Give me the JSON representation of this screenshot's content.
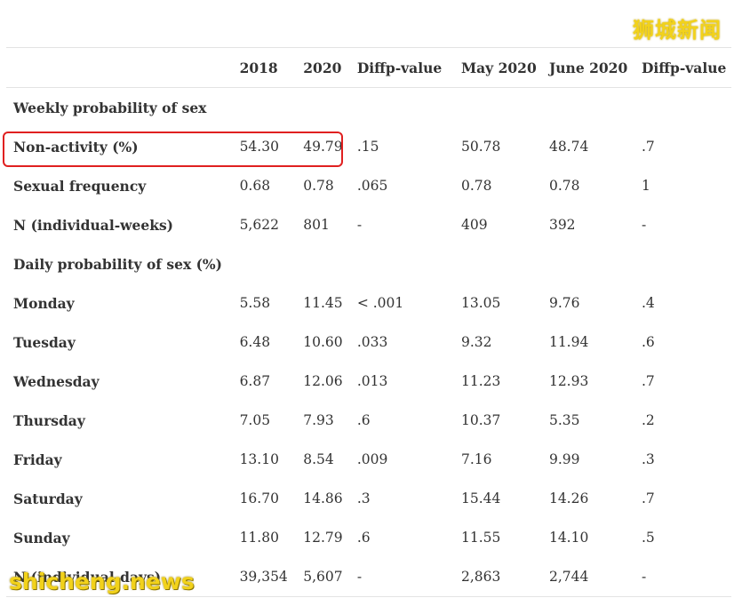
{
  "watermarks": {
    "top": "狮城新闻",
    "bottom": "shicheng.news"
  },
  "table": {
    "headers": [
      "",
      "2018",
      "2020",
      "Diffp-value",
      "May 2020",
      "June 2020",
      "Diffp-value"
    ],
    "rows": [
      {
        "type": "section",
        "label": "Weekly probability of sex",
        "cells": []
      },
      {
        "type": "data",
        "label": "Non-activity (%)",
        "cells": [
          "54.30",
          "49.79",
          ".15",
          "50.78",
          "48.74",
          ".7"
        ],
        "highlighted": true
      },
      {
        "type": "data",
        "label": "Sexual frequency",
        "cells": [
          "0.68",
          "0.78",
          ".065",
          "0.78",
          "0.78",
          "1"
        ]
      },
      {
        "type": "data",
        "label": "N (individual-weeks)",
        "cells": [
          "5,622",
          "801",
          "-",
          "409",
          "392",
          "-"
        ]
      },
      {
        "type": "section",
        "label": "Daily probability of sex (%)",
        "cells": []
      },
      {
        "type": "data",
        "label": "Monday",
        "cells": [
          "5.58",
          "11.45",
          "< .001",
          "13.05",
          "9.76",
          ".4"
        ]
      },
      {
        "type": "data",
        "label": "Tuesday",
        "cells": [
          "6.48",
          "10.60",
          ".033",
          "9.32",
          "11.94",
          ".6"
        ]
      },
      {
        "type": "data",
        "label": "Wednesday",
        "cells": [
          "6.87",
          "12.06",
          ".013",
          "11.23",
          "12.93",
          ".7"
        ]
      },
      {
        "type": "data",
        "label": "Thursday",
        "cells": [
          "7.05",
          "7.93",
          ".6",
          "10.37",
          "5.35",
          ".2"
        ]
      },
      {
        "type": "data",
        "label": "Friday",
        "cells": [
          "13.10",
          "8.54",
          ".009",
          "7.16",
          "9.99",
          ".3"
        ]
      },
      {
        "type": "data",
        "label": "Saturday",
        "cells": [
          "16.70",
          "14.86",
          ".3",
          "15.44",
          "14.26",
          ".7"
        ]
      },
      {
        "type": "data",
        "label": "Sunday",
        "cells": [
          "11.80",
          "12.79",
          ".6",
          "11.55",
          "14.10",
          ".5"
        ]
      },
      {
        "type": "data",
        "label": "N (individual-days)",
        "cells": [
          "39,354",
          "5,607",
          "-",
          "2,863",
          "2,744",
          "-"
        ]
      }
    ]
  },
  "colors": {
    "highlight": "#e02020",
    "watermark": "#f2d21b",
    "rule": "#e3e3e3"
  }
}
